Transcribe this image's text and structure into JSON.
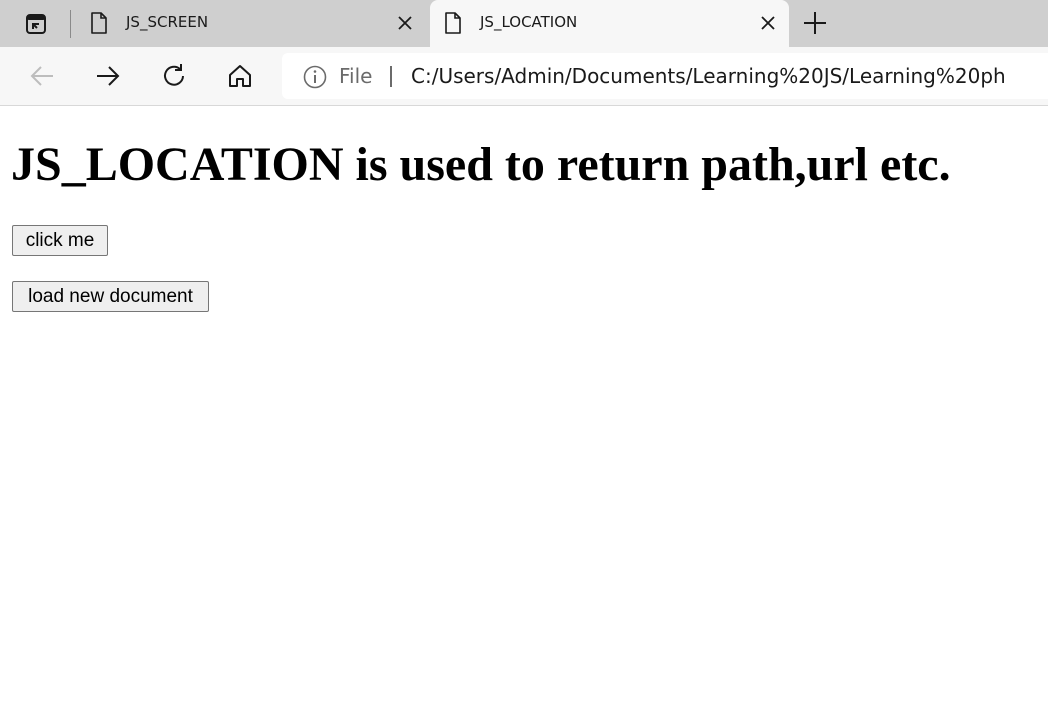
{
  "browser": {
    "tabs": [
      {
        "title": "JS_SCREEN",
        "active": false
      },
      {
        "title": "JS_LOCATION",
        "active": true
      }
    ],
    "address_bar": {
      "scheme_label": "File",
      "url": "C:/Users/Admin/Documents/Learning%20JS/Learning%20ph"
    }
  },
  "page": {
    "heading": "JS_LOCATION is used to return path,url etc.",
    "buttons": {
      "click_me": "click me",
      "load_new_document": "load new document"
    }
  }
}
